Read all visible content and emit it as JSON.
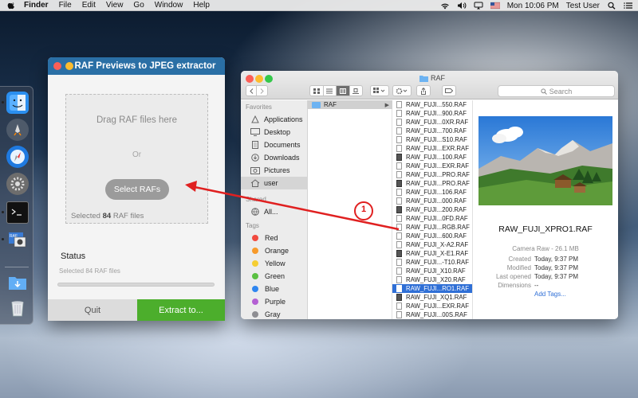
{
  "menubar": {
    "app_name": "Finder",
    "items": [
      "File",
      "Edit",
      "View",
      "Go",
      "Window",
      "Help"
    ],
    "clock": "Mon 10:06 PM",
    "user": "Test User"
  },
  "raf_app": {
    "title": "RAF Previews to JPEG extractor",
    "drop_hint": "Drag RAF files here",
    "or_text": "Or",
    "select_button": "Select RAFs",
    "selected_prefix": "Selected",
    "selected_count": "84",
    "selected_suffix": "RAF files",
    "status_heading": "Status",
    "status_text": "Selected 84 RAF files",
    "progress_fraction": 0,
    "quit_button": "Quit",
    "extract_button": "Extract to..."
  },
  "finder": {
    "title": "RAF",
    "search_placeholder": "Search",
    "sidebar": {
      "favorites_heading": "Favorites",
      "favorites": [
        "Applications",
        "Desktop",
        "Documents",
        "Downloads",
        "Pictures",
        "user"
      ],
      "devices_heading": "Shared",
      "devices": [
        "All..."
      ],
      "tags_heading": "Tags",
      "tags": [
        {
          "name": "Red",
          "color": "#f14a3f"
        },
        {
          "name": "Orange",
          "color": "#f79a2b"
        },
        {
          "name": "Yellow",
          "color": "#f5ce33"
        },
        {
          "name": "Green",
          "color": "#5ac042"
        },
        {
          "name": "Blue",
          "color": "#2f86f0"
        },
        {
          "name": "Purple",
          "color": "#b460d3"
        },
        {
          "name": "Gray",
          "color": "#8e8e93"
        }
      ]
    },
    "column1_item": "RAF",
    "files": [
      {
        "name": "RAW_FUJI...550.RAF",
        "camera": false
      },
      {
        "name": "RAW_FUJI...900.RAF",
        "camera": false
      },
      {
        "name": "RAW_FUJI...0XR.RAF",
        "camera": false
      },
      {
        "name": "RAW_FUJI...700.RAF",
        "camera": false
      },
      {
        "name": "RAW_FUJI...S10.RAF",
        "camera": false
      },
      {
        "name": "RAW_FUJI...EXR.RAF",
        "camera": false
      },
      {
        "name": "RAW_FUJI...100.RAF",
        "camera": true
      },
      {
        "name": "RAW_FUJI...EXR.RAF",
        "camera": false
      },
      {
        "name": "RAW_FUJI...PRO.RAF",
        "camera": false
      },
      {
        "name": "RAW_FUJI...PRO.RAF",
        "camera": true
      },
      {
        "name": "RAW_FUJI...106.RAF",
        "camera": false
      },
      {
        "name": "RAW_FUJI...000.RAF",
        "camera": false
      },
      {
        "name": "RAW_FUJI...200.RAF",
        "camera": true
      },
      {
        "name": "RAW_FUJI...0FD.RAF",
        "camera": false
      },
      {
        "name": "RAW_FUJI...RGB.RAF",
        "camera": false
      },
      {
        "name": "RAW_FUJI...600.RAF",
        "camera": false
      },
      {
        "name": "RAW_FUJI_X-A2.RAF",
        "camera": false
      },
      {
        "name": "RAW_FUJI_X-E1.RAF",
        "camera": true
      },
      {
        "name": "RAW_FUJI...-T10.RAF",
        "camera": false
      },
      {
        "name": "RAW_FUJI_X10.RAF",
        "camera": false
      },
      {
        "name": "RAW_FUJI_X20.RAF",
        "camera": false
      },
      {
        "name": "RAW_FUJI...RO1.RAF",
        "camera": false,
        "selected": true
      },
      {
        "name": "RAW_FUJI_XQ1.RAF",
        "camera": true
      },
      {
        "name": "RAW_FUJI...EXR.RAF",
        "camera": false
      },
      {
        "name": "RAW_FUJI...00S.RAF",
        "camera": false
      }
    ],
    "preview": {
      "file_name": "RAW_FUJI_XPRO1.RAF",
      "kind": "Camera Raw - 26.1 MB",
      "rows": [
        {
          "label": "Created",
          "value": "Today, 9:37 PM"
        },
        {
          "label": "Modified",
          "value": "Today, 9:37 PM"
        },
        {
          "label": "Last opened",
          "value": "Today, 9:37 PM"
        },
        {
          "label": "Dimensions",
          "value": "--"
        }
      ],
      "add_tags": "Add Tags..."
    }
  },
  "annotation": {
    "badge": "1",
    "color": "#e02020"
  }
}
